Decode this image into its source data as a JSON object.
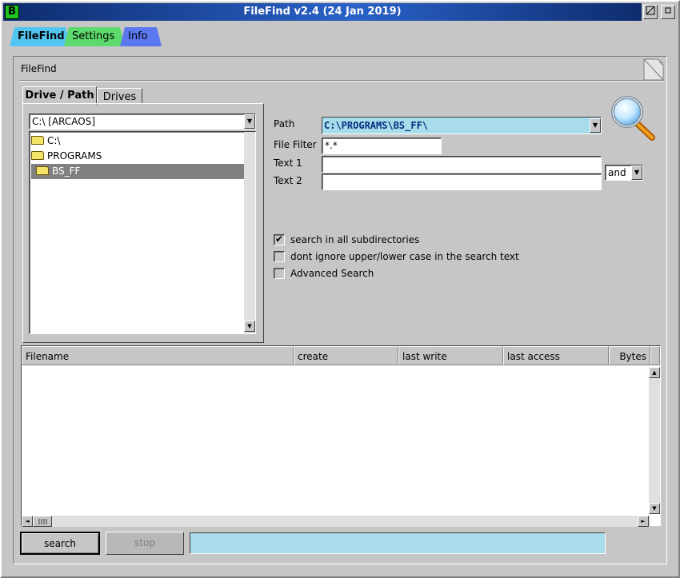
{
  "window": {
    "title": "FileFind   v2.4 (24 Jan 2019)",
    "app_icon_glyph": "B"
  },
  "tabs": [
    {
      "label": "FileFind",
      "color": "#52c6f0"
    },
    {
      "label": "Settings",
      "color": "#5dd96d"
    },
    {
      "label": "Info",
      "color": "#5a78f0"
    }
  ],
  "panel": {
    "title": "FileFind"
  },
  "inner_tabs": [
    {
      "label": "Drive / Path"
    },
    {
      "label": "Drives"
    }
  ],
  "drive": {
    "selected": "C:\\ [ARCAOS]",
    "tree": [
      {
        "label": "C:\\"
      },
      {
        "label": "PROGRAMS"
      },
      {
        "label": "BS_FF"
      }
    ]
  },
  "form": {
    "path_label": "Path",
    "path_value": "C:\\PROGRAMS\\BS_FF\\",
    "filter_label": "File Filter",
    "filter_value": "*.*",
    "text1_label": "Text 1",
    "text1_value": "",
    "text2_label": "Text 2",
    "text2_value": "",
    "operator": "and"
  },
  "options": [
    {
      "label": "search in all subdirectories",
      "checked": true
    },
    {
      "label": "dont ignore upper/lower case in the search text",
      "checked": false
    },
    {
      "label": "Advanced Search",
      "checked": false
    }
  ],
  "results": {
    "columns": [
      {
        "label": "Filename"
      },
      {
        "label": "create"
      },
      {
        "label": "last write"
      },
      {
        "label": "last access"
      },
      {
        "label": "Bytes"
      }
    ]
  },
  "buttons": {
    "search": "search",
    "stop": "stop"
  },
  "status": {
    "text": ""
  },
  "icons": {
    "check": "✔",
    "arrow_down": "▼",
    "arrow_up": "▲",
    "arrow_left": "◄",
    "arrow_right": "►"
  }
}
